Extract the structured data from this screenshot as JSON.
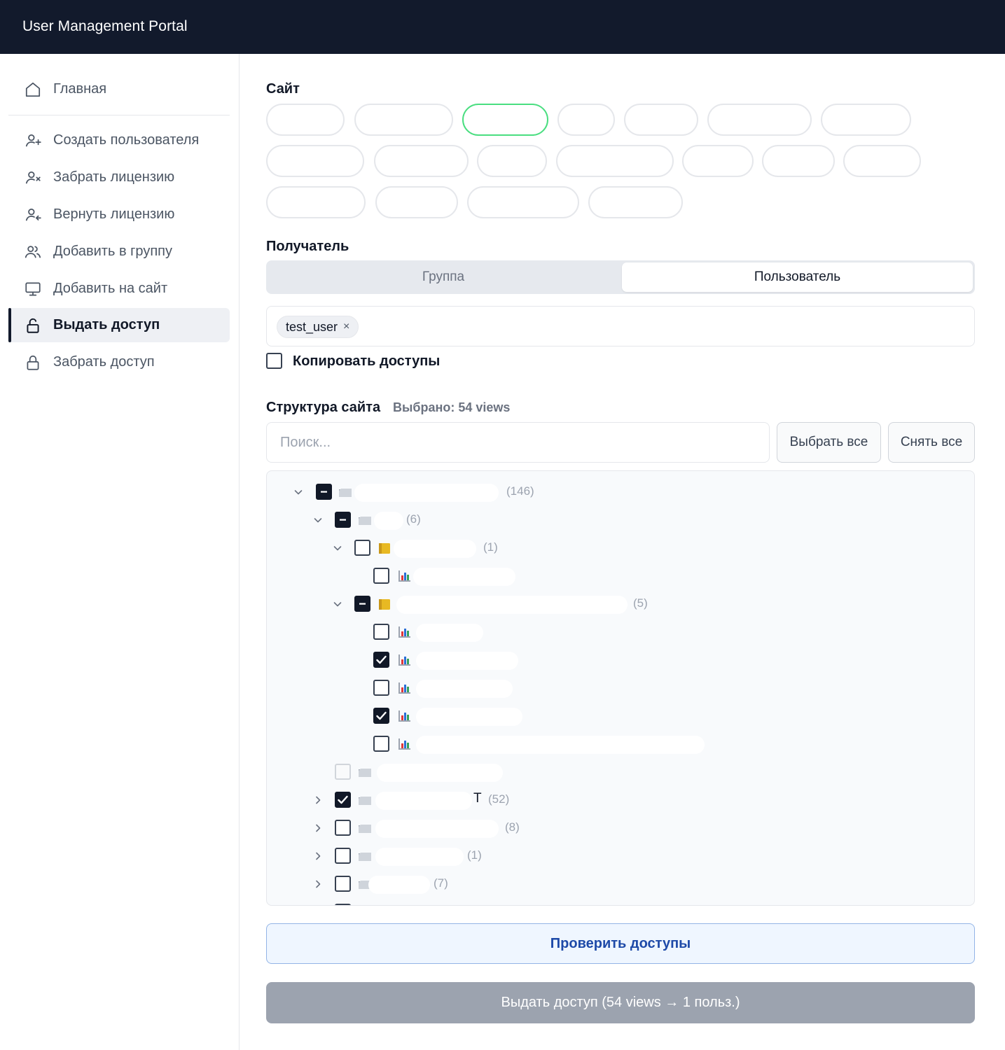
{
  "app": {
    "title": "User Management Portal"
  },
  "sidebar": {
    "items": [
      {
        "label": "Главная",
        "icon": "home-icon",
        "active": false
      },
      {
        "label": "Создать пользователя",
        "icon": "user-plus-icon",
        "active": false
      },
      {
        "label": "Забрать лицензию",
        "icon": "user-x-icon",
        "active": false
      },
      {
        "label": "Вернуть лицензию",
        "icon": "user-return-icon",
        "active": false
      },
      {
        "label": "Добавить в группу",
        "icon": "users-icon",
        "active": false
      },
      {
        "label": "Добавить на сайт",
        "icon": "monitor-icon",
        "active": false
      },
      {
        "label": "Выдать доступ",
        "icon": "lock-open-icon",
        "active": true
      },
      {
        "label": "Забрать доступ",
        "icon": "lock-icon",
        "active": false
      }
    ]
  },
  "site": {
    "label": "Сайт"
  },
  "recipient": {
    "label": "Получатель",
    "tabs": [
      "Группа",
      "Пользователь"
    ],
    "active_tab": "Пользователь",
    "chips": [
      "test_user"
    ],
    "chip_remove": "×"
  },
  "copy_access": {
    "label": "Копировать доступы",
    "checked": false
  },
  "structure": {
    "title": "Структура сайта",
    "selected_text": "Выбрано: 54 views",
    "search_placeholder": "Поиск...",
    "select_all": "Выбрать все",
    "clear_all": "Снять все",
    "counts": [
      "(146)",
      "(6)",
      "(1)",
      "(5)",
      "(52)",
      "(8)",
      "(1)",
      "(7)"
    ],
    "fragments": [
      "T"
    ]
  },
  "actions": {
    "check": "Проверить доступы",
    "grant": "Выдать доступ (54 views → 1 польз.)"
  },
  "colors": {
    "topbar": "#121a2c",
    "selected_site_border": "#4ade80",
    "check_button_text": "#1e4aa8",
    "grant_button_bg": "#9ca3af"
  }
}
